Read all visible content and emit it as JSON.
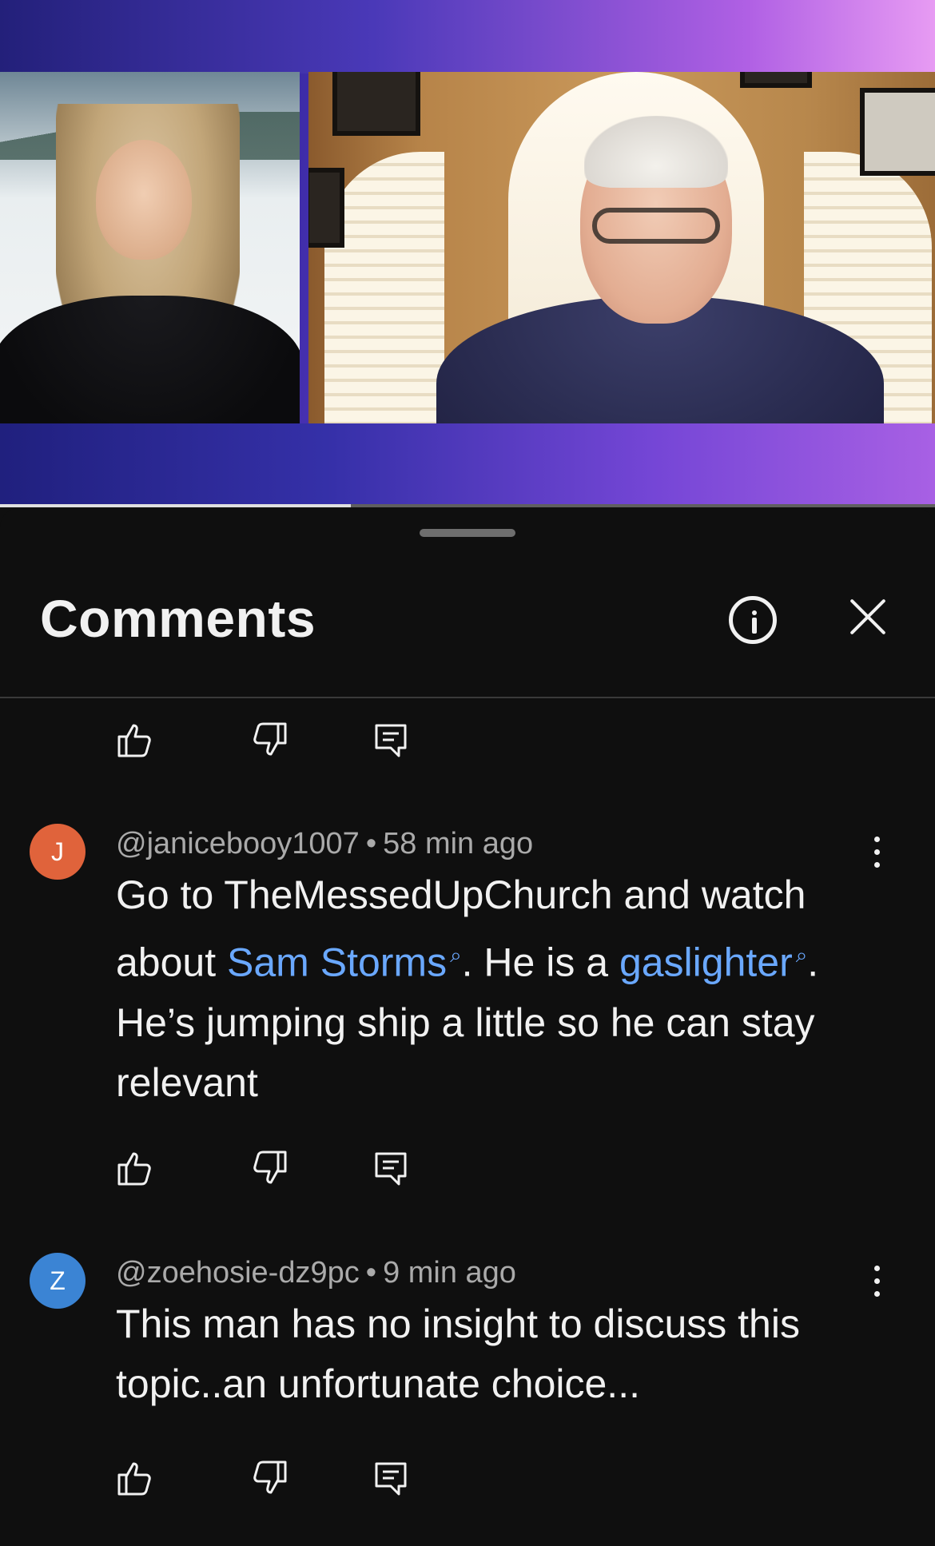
{
  "video": {
    "progress_fraction": 0.375
  },
  "comments_panel": {
    "title": "Comments",
    "info_icon": "info-icon",
    "close_icon": "close-icon",
    "handle_icon": "drag-handle"
  },
  "actions": {
    "like_icon": "thumb-up-icon",
    "dislike_icon": "thumb-down-icon",
    "reply_icon": "reply-icon"
  },
  "comments": [
    {
      "avatar_letter": "J",
      "avatar_color": "#e0633b",
      "author": "@janicebooy1007",
      "separator": "•",
      "time": "58 min ago",
      "text_parts": {
        "p1": "Go to TheMessedUpChurch and watch about ",
        "link1": "Sam Storms",
        "p2": ". He is a ",
        "link2": "gaslighter",
        "p3": ". He’s jumping ship a little so he can stay relevant"
      }
    },
    {
      "avatar_letter": "Z",
      "avatar_color": "#3b84d4",
      "author": "@zoehosie-dz9pc",
      "separator": "•",
      "time": "9 min ago",
      "text": "This man has no insight to discuss this topic..an unfortunate choice..."
    }
  ],
  "colors": {
    "background": "#0f0f0f",
    "text": "#f1f1f1",
    "muted": "#aaaaaa",
    "link": "#6aa8ff"
  }
}
